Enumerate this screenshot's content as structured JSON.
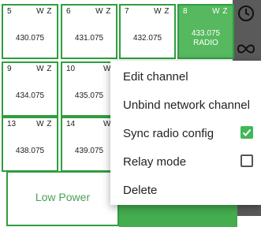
{
  "channels": [
    {
      "num": "5",
      "wz": "W Z",
      "freq": "430.075",
      "active": false
    },
    {
      "num": "6",
      "wz": "W Z",
      "freq": "431.075",
      "active": false
    },
    {
      "num": "7",
      "wz": "W Z",
      "freq": "432.075",
      "active": false
    },
    {
      "num": "8",
      "wz": "W Z",
      "freq": "433.075",
      "radio": "RADIO",
      "active": true
    },
    {
      "num": "9",
      "wz": "W Z",
      "freq": "434.075",
      "active": false
    },
    {
      "num": "10",
      "wz": "W",
      "freq": "435.075",
      "active": false
    },
    {
      "num": "13",
      "wz": "W Z",
      "freq": "438.075",
      "active": false
    },
    {
      "num": "14",
      "wz": "W",
      "freq": "439.075",
      "active": false
    }
  ],
  "bottom": {
    "low_power_label": "Low Power"
  },
  "side_icons": [
    "clock-icon",
    "infinity-icon"
  ],
  "menu": {
    "items": [
      {
        "label": "Edit channel"
      },
      {
        "label": "Unbind network channel"
      },
      {
        "label": "Sync radio config",
        "checkbox": "checked"
      },
      {
        "label": "Relay mode",
        "checkbox": "unchecked"
      },
      {
        "label": "Delete"
      }
    ]
  },
  "colors": {
    "accent": "#56b85f",
    "border": "#2f9e3f",
    "check": "#41b857"
  }
}
